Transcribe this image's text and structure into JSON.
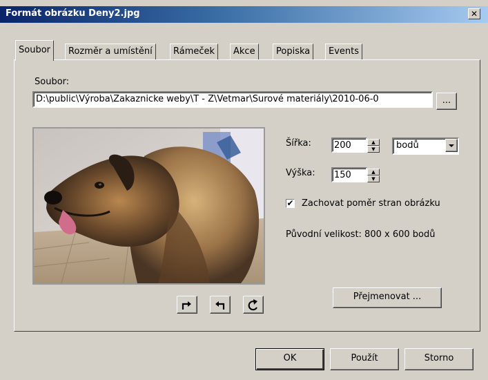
{
  "window": {
    "title": "Formát obrázku Deny2.jpg",
    "close": "✕"
  },
  "tabs": [
    {
      "label": "Soubor",
      "active": true
    },
    {
      "label": "Rozměr a umístění"
    },
    {
      "label": "Rámeček"
    },
    {
      "label": "Akce"
    },
    {
      "label": "Popiska"
    },
    {
      "label": "Events"
    }
  ],
  "file": {
    "label": "Soubor:",
    "path": "D:\\public\\Výroba\\Zakaznicke weby\\T - Z\\Vetmar\\Surové materiály\\2010-06-0",
    "browse": "..."
  },
  "size": {
    "width_label": "Šířka:",
    "width_value": "200",
    "height_label": "Výška:",
    "height_value": "150",
    "unit": "bodů",
    "keep_ratio_label": "Zachovat poměr stran obrázku",
    "keep_ratio_checked": true,
    "original_text": "Původní velikost: 800 x 600 bodů"
  },
  "rotate": {
    "icons": [
      "rotate-right-icon",
      "undo-icon",
      "redo-icon"
    ]
  },
  "rename_button": "Přejmenovat ...",
  "footer": {
    "ok": "OK",
    "apply": "Použít",
    "cancel": "Storno"
  }
}
